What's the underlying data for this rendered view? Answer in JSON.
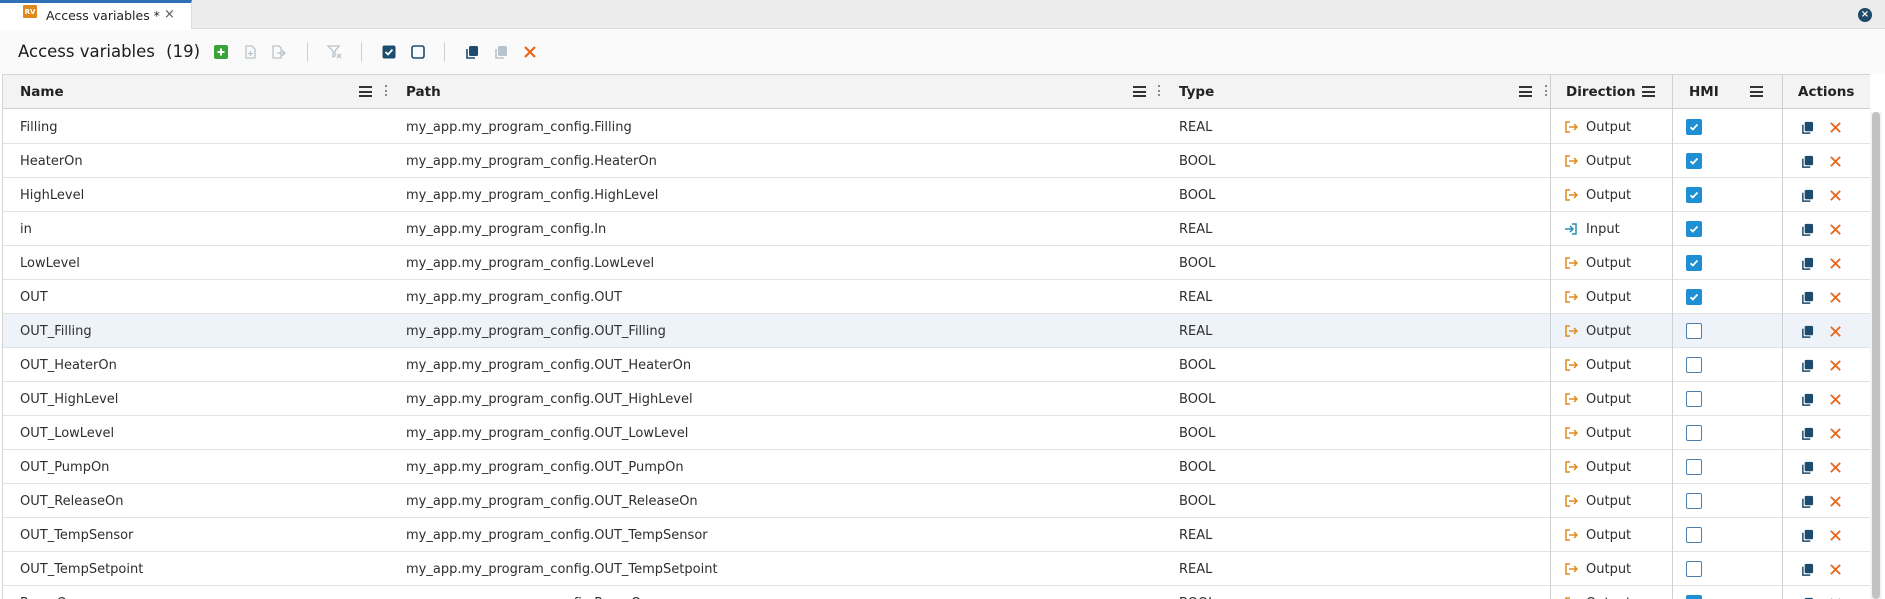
{
  "tab": {
    "label": "Access variables *",
    "icon": "rv-editor-icon",
    "icon_text": "RV",
    "close": "×"
  },
  "window": {
    "close": "×"
  },
  "toolbar": {
    "title": "Access variables",
    "count": "(19)"
  },
  "columns": {
    "name": "Name",
    "path": "Path",
    "type": "Type",
    "direction": "Direction",
    "hmi": "HMI",
    "actions": "Actions"
  },
  "colors": {
    "accent": "#1f8fd4",
    "output": "#e08a1e",
    "input": "#2a8fb5",
    "delete": "#e8651a",
    "add": "#3aa335",
    "selected_row": "#eef3fa"
  },
  "rows": [
    {
      "name": "Filling",
      "path": "my_app.my_program_config.Filling",
      "type": "REAL",
      "direction": "Output",
      "hmi": true
    },
    {
      "name": "HeaterOn",
      "path": "my_app.my_program_config.HeaterOn",
      "type": "BOOL",
      "direction": "Output",
      "hmi": true
    },
    {
      "name": "HighLevel",
      "path": "my_app.my_program_config.HighLevel",
      "type": "BOOL",
      "direction": "Output",
      "hmi": true
    },
    {
      "name": "in",
      "path": "my_app.my_program_config.In",
      "type": "REAL",
      "direction": "Input",
      "hmi": true
    },
    {
      "name": "LowLevel",
      "path": "my_app.my_program_config.LowLevel",
      "type": "BOOL",
      "direction": "Output",
      "hmi": true
    },
    {
      "name": "OUT",
      "path": "my_app.my_program_config.OUT",
      "type": "REAL",
      "direction": "Output",
      "hmi": true
    },
    {
      "name": "OUT_Filling",
      "path": "my_app.my_program_config.OUT_Filling",
      "type": "REAL",
      "direction": "Output",
      "hmi": false,
      "selected": true
    },
    {
      "name": "OUT_HeaterOn",
      "path": "my_app.my_program_config.OUT_HeaterOn",
      "type": "BOOL",
      "direction": "Output",
      "hmi": false
    },
    {
      "name": "OUT_HighLevel",
      "path": "my_app.my_program_config.OUT_HighLevel",
      "type": "BOOL",
      "direction": "Output",
      "hmi": false
    },
    {
      "name": "OUT_LowLevel",
      "path": "my_app.my_program_config.OUT_LowLevel",
      "type": "BOOL",
      "direction": "Output",
      "hmi": false
    },
    {
      "name": "OUT_PumpOn",
      "path": "my_app.my_program_config.OUT_PumpOn",
      "type": "BOOL",
      "direction": "Output",
      "hmi": false
    },
    {
      "name": "OUT_ReleaseOn",
      "path": "my_app.my_program_config.OUT_ReleaseOn",
      "type": "BOOL",
      "direction": "Output",
      "hmi": false
    },
    {
      "name": "OUT_TempSensor",
      "path": "my_app.my_program_config.OUT_TempSensor",
      "type": "REAL",
      "direction": "Output",
      "hmi": false
    },
    {
      "name": "OUT_TempSetpoint",
      "path": "my_app.my_program_config.OUT_TempSetpoint",
      "type": "REAL",
      "direction": "Output",
      "hmi": false
    },
    {
      "name": "PumpOn",
      "path": "my_app.my_program_config.PumpOn",
      "type": "BOOL",
      "direction": "Output",
      "hmi": true
    }
  ]
}
